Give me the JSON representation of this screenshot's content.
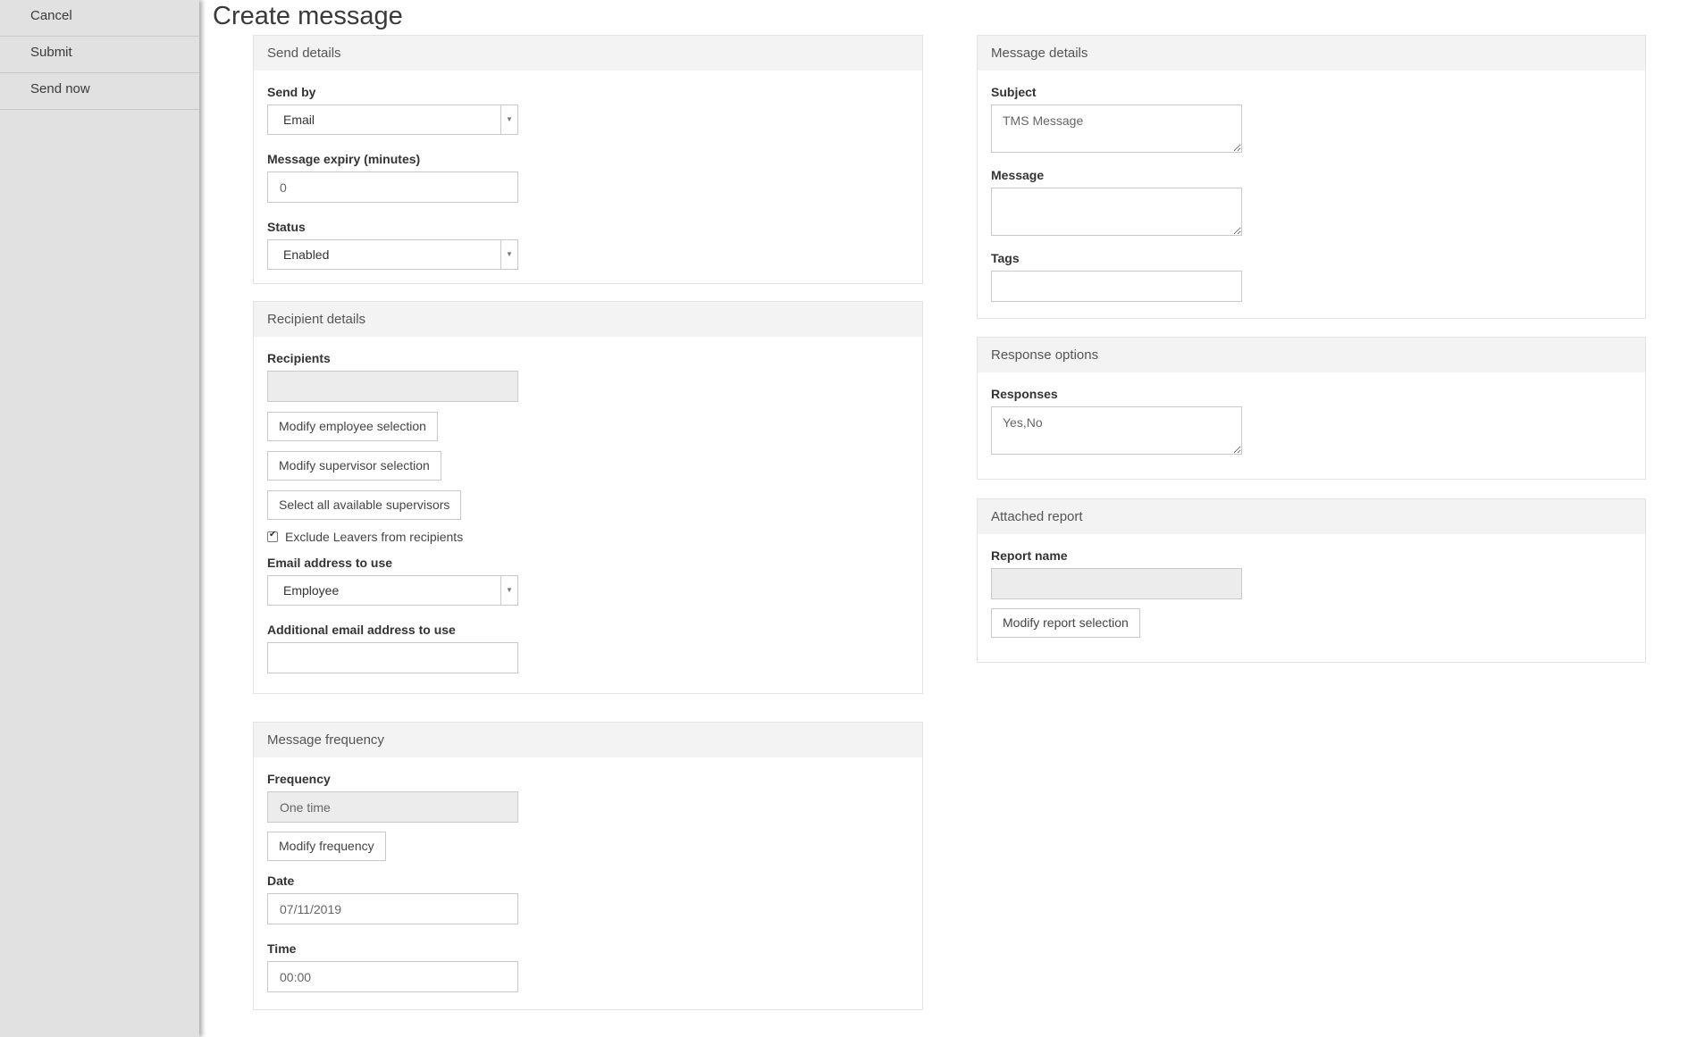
{
  "sidebar": {
    "items": [
      {
        "label": "Cancel"
      },
      {
        "label": "Submit"
      },
      {
        "label": "Send now"
      }
    ]
  },
  "page": {
    "title": "Create message"
  },
  "send_details": {
    "title": "Send details",
    "send_by": {
      "label": "Send by",
      "value": "Email"
    },
    "expiry": {
      "label": "Message expiry (minutes)",
      "value": "0"
    },
    "status": {
      "label": "Status",
      "value": "Enabled"
    }
  },
  "recipient_details": {
    "title": "Recipient details",
    "recipients": {
      "label": "Recipients",
      "value": ""
    },
    "buttons": {
      "modify_employee": "Modify employee selection",
      "modify_supervisor": "Modify supervisor selection",
      "select_all_supervisors": "Select all available supervisors"
    },
    "exclude_leavers": {
      "label": "Exclude Leavers from recipients",
      "checked": true
    },
    "email_address": {
      "label": "Email address to use",
      "value": "Employee"
    },
    "additional_email": {
      "label": "Additional email address to use",
      "value": ""
    }
  },
  "message_frequency": {
    "title": "Message frequency",
    "frequency": {
      "label": "Frequency",
      "value": "One time"
    },
    "modify_frequency": "Modify frequency",
    "date": {
      "label": "Date",
      "value": "07/11/2019"
    },
    "time": {
      "label": "Time",
      "value": "00:00"
    }
  },
  "message_details": {
    "title": "Message details",
    "subject": {
      "label": "Subject",
      "value": "TMS Message"
    },
    "message": {
      "label": "Message",
      "value": ""
    },
    "tags": {
      "label": "Tags",
      "value": ""
    }
  },
  "response_options": {
    "title": "Response options",
    "responses": {
      "label": "Responses",
      "value": "Yes,No"
    }
  },
  "attached_report": {
    "title": "Attached report",
    "report_name": {
      "label": "Report name",
      "value": ""
    },
    "modify_report": "Modify report selection"
  }
}
